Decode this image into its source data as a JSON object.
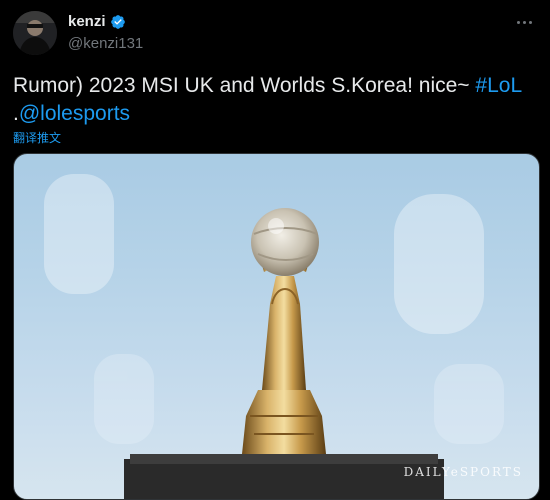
{
  "author": {
    "display_name": "kenzi",
    "handle": "@kenzi131",
    "verified": true,
    "avatar_icon": "profile-avatar"
  },
  "more_icon": "more-options-icon",
  "tweet": {
    "line1_text": "Rumor) 2023 MSI UK and Worlds S.Korea! nice~ ",
    "line1_hashtag": "#LoL",
    "line2_prefix": ".",
    "line2_mention": "@lolesports"
  },
  "translate_label": "翻译推文",
  "media": {
    "description_icon": "trophy-image",
    "watermark": "DAILYeSPORTS"
  },
  "colors": {
    "background": "#000000",
    "text": "#e7e9ea",
    "secondary_text": "#71767b",
    "link": "#1d9bf0",
    "verified_badge": "#1d9bf0"
  }
}
